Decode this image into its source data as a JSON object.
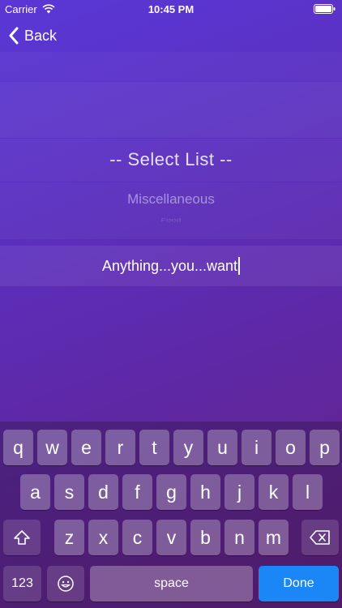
{
  "status_bar": {
    "carrier": "Carrier",
    "time": "10:45 PM",
    "wifi_icon": "wifi-icon",
    "battery_icon": "battery-icon"
  },
  "nav": {
    "back_label": "Back",
    "back_icon": "chevron-left-icon"
  },
  "picker": {
    "selected": "-- Select List --",
    "options": [
      "Miscellaneous",
      "Food"
    ]
  },
  "text_field": {
    "value": "Anything...you...want"
  },
  "keyboard": {
    "row1": [
      "q",
      "w",
      "e",
      "r",
      "t",
      "y",
      "u",
      "i",
      "o",
      "p"
    ],
    "row2": [
      "a",
      "s",
      "d",
      "f",
      "g",
      "h",
      "j",
      "k",
      "l"
    ],
    "row3": [
      "z",
      "x",
      "c",
      "v",
      "b",
      "n",
      "m"
    ],
    "numbers_label": "123",
    "space_label": "space",
    "done_label": "Done",
    "shift_icon": "shift-icon",
    "delete_icon": "delete-icon",
    "emoji_icon": "emoji-icon"
  },
  "colors": {
    "done_key": "#1b87f7",
    "background_top": "#5a37d6",
    "background_bottom": "#66207f"
  }
}
